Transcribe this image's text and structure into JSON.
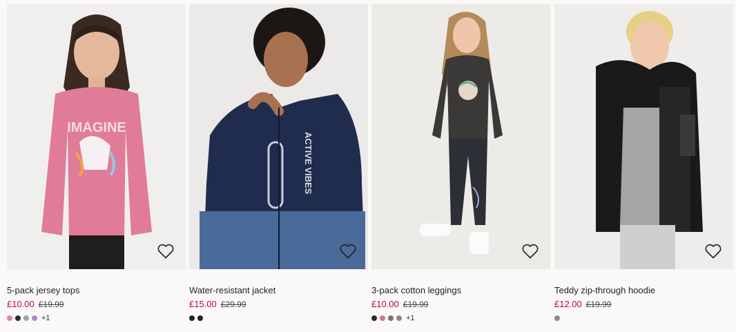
{
  "products": [
    {
      "name": "5-pack jersey tops",
      "price": "£10.00",
      "old_price": "£19.99",
      "swatches": [
        "#d98aa7",
        "#2b2b2b",
        "#a3a3a3",
        "#a98ac9"
      ],
      "more": "+1"
    },
    {
      "name": "Water-resistant jacket",
      "price": "£15.00",
      "old_price": "£29.99",
      "swatches": [
        "#242424",
        "#242424"
      ],
      "more": ""
    },
    {
      "name": "3-pack cotton leggings",
      "price": "£10.00",
      "old_price": "£19.99",
      "swatches": [
        "#2a2a2a",
        "#c27f8a",
        "#8a6a6a",
        "#8a8a8a"
      ],
      "more": "+1"
    },
    {
      "name": "Teddy zip-through hoodie",
      "price": "£12.00",
      "old_price": "£19.99",
      "swatches": [
        "#8c8c8c"
      ],
      "more": ""
    }
  ]
}
